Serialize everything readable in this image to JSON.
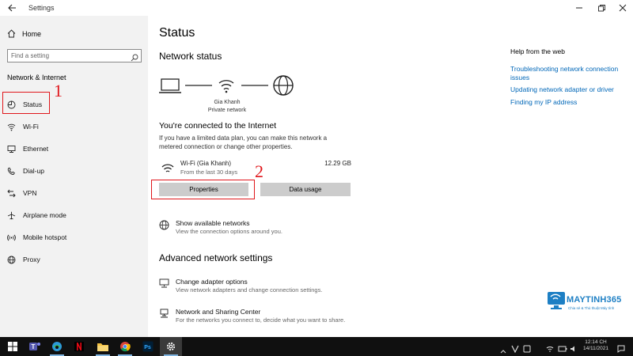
{
  "window": {
    "title": "Settings"
  },
  "sidebar": {
    "home_label": "Home",
    "search_placeholder": "Find a setting",
    "section_title": "Network & Internet",
    "items": [
      {
        "label": "Status",
        "icon": "status-globe-icon"
      },
      {
        "label": "Wi-Fi",
        "icon": "wifi-icon"
      },
      {
        "label": "Ethernet",
        "icon": "ethernet-icon"
      },
      {
        "label": "Dial-up",
        "icon": "dialup-icon"
      },
      {
        "label": "VPN",
        "icon": "vpn-icon"
      },
      {
        "label": "Airplane mode",
        "icon": "airplane-icon"
      },
      {
        "label": "Mobile hotspot",
        "icon": "hotspot-icon"
      },
      {
        "label": "Proxy",
        "icon": "globe-icon"
      }
    ]
  },
  "annotations": {
    "step1": "1",
    "step2": "2",
    "color": "#e0161b"
  },
  "main": {
    "title": "Status",
    "network_status_heading": "Network status",
    "network_name": "Gia Khanh",
    "network_type": "Private network",
    "connected_heading": "You're connected to the Internet",
    "connected_desc": "If you have a limited data plan, you can make this network a metered connection or change other properties.",
    "connection": {
      "name": "Wi-Fi (Gia Khanh)",
      "sub": "From the last 30 days",
      "size": "12.29 GB"
    },
    "properties_button": "Properties",
    "data_usage_button": "Data usage",
    "show_networks": {
      "title": "Show available networks",
      "sub": "View the connection options around you."
    },
    "advanced_heading": "Advanced network settings",
    "change_adapter": {
      "title": "Change adapter options",
      "sub": "View network adapters and change connection settings."
    },
    "sharing_center": {
      "title": "Network and Sharing Center",
      "sub": "For the networks you connect to, decide what you want to share."
    }
  },
  "help": {
    "title": "Help from the web",
    "links": [
      "Troubleshooting network connection issues",
      "Updating network adapter or driver",
      "Finding my IP address"
    ]
  },
  "watermark": {
    "brand": "MAYTINH365",
    "tagline": "Chia sẻ & Thủ thuật Máy tính"
  },
  "taskbar": {
    "time": "12:14 CH",
    "date": "14/11/2021",
    "accent": "#7fb4e0"
  },
  "colors": {
    "link": "#0067b8",
    "sidebar_bg": "#f2f2f2",
    "button_bg": "#cccccc"
  }
}
